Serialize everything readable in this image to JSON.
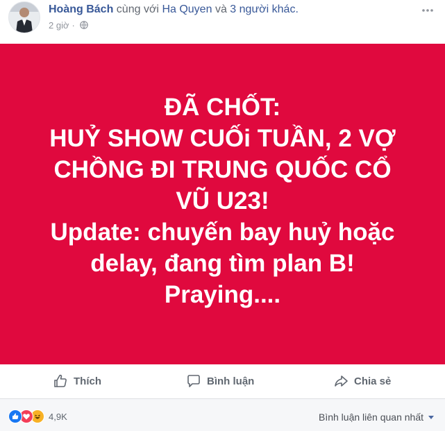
{
  "post": {
    "author": "Hoàng Bách",
    "with_text": "cùng với",
    "tagged": "Ha Quyen",
    "and_text": "và",
    "others": "3 người khác.",
    "time": "2 giờ",
    "dot": "·",
    "privacy_icon": "globe-icon",
    "more_icon": "ellipsis-icon"
  },
  "content": {
    "background": "#e0093e",
    "lines": [
      "ĐÃ CHỐT:",
      "HUỶ SHOW CUỐi TUẦN, 2 VỢ",
      "CHỒNG ĐI TRUNG QUỐC CỔ",
      "VŨ U23!",
      "Update: chuyến bay huỷ hoặc",
      "delay, đang tìm plan B!",
      "Praying...."
    ]
  },
  "actions": {
    "like": "Thích",
    "comment": "Bình luận",
    "share": "Chia sẻ"
  },
  "footer": {
    "reaction_count": "4,9K",
    "reactions": [
      "like",
      "love",
      "haha"
    ],
    "sort_label": "Bình luận liên quan nhất"
  }
}
